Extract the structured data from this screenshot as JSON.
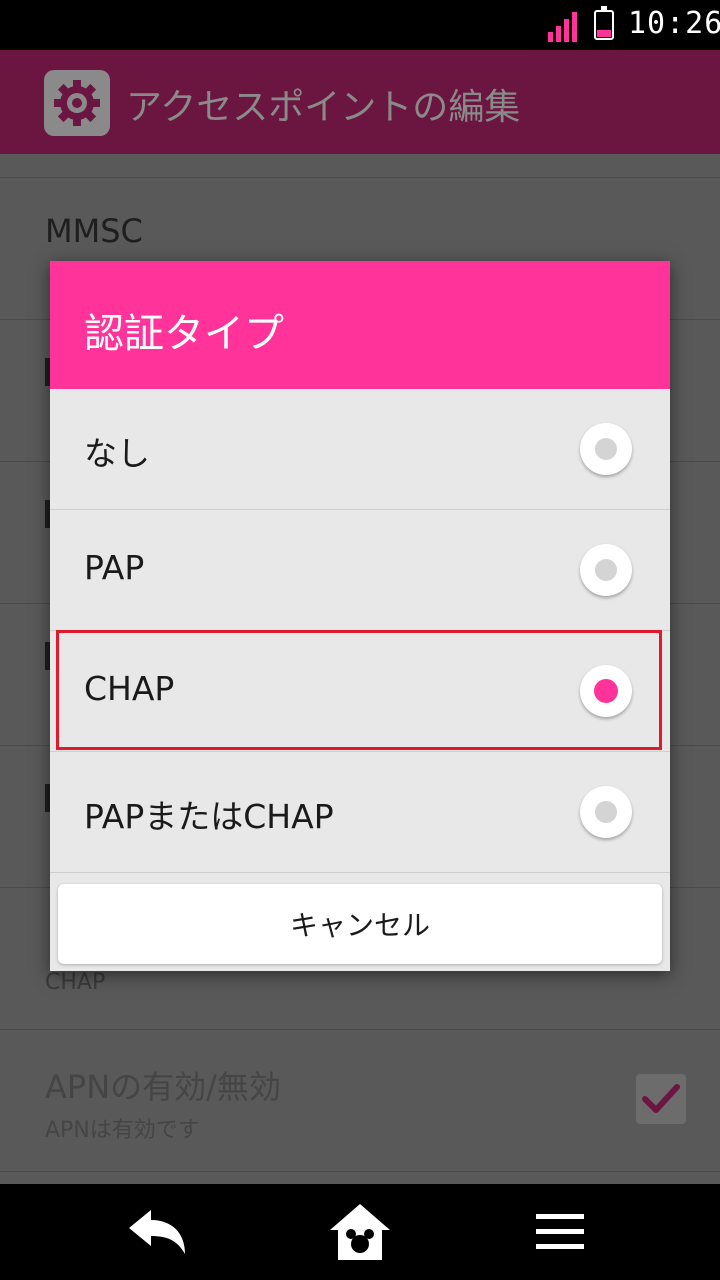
{
  "status": {
    "time": "10:26",
    "accent": "#ff3399"
  },
  "header": {
    "title": "アクセスポイントの編集",
    "icon": "gear-icon"
  },
  "settings": {
    "mmsc_title": "MMSC",
    "auth_value": "CHAP",
    "apn_toggle_title": "APNの有効/無効",
    "apn_toggle_sub": "APNは有効です",
    "apn_enabled": true
  },
  "dialog": {
    "title": "認証タイプ",
    "options": [
      {
        "label": "なし",
        "selected": false
      },
      {
        "label": "PAP",
        "selected": false
      },
      {
        "label": "CHAP",
        "selected": true
      },
      {
        "label": "PAPまたはCHAP",
        "selected": false
      }
    ],
    "cancel_label": "キャンセル"
  },
  "navbar": {
    "icons": [
      "back-icon",
      "home-icon",
      "menu-icon"
    ]
  }
}
